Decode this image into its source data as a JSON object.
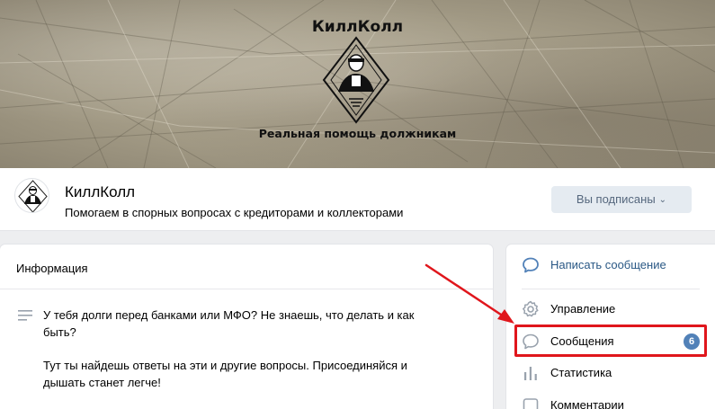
{
  "cover": {
    "title": "КиллКолл",
    "tagline": "Реальная помощь должникам"
  },
  "group": {
    "name": "КиллКолл",
    "description": "Помогаем в спорных вопросах с кредиторами и коллекторами",
    "subscribe_button": "Вы подписаны",
    "subscribe_icon": "chevron-down-icon"
  },
  "info": {
    "title": "Информация",
    "paragraph_1": "У тебя долги перед банками или МФО? Не знаешь, что делать и как быть?",
    "paragraph_2": "Тут ты найдешь ответы на эти и другие вопросы. Присоединяйся и дышать станет легче!"
  },
  "actions": {
    "write_message": "Написать сообщение",
    "manage": "Управление",
    "messages": "Сообщения",
    "messages_count": "6",
    "statistics": "Статистика",
    "comments": "Комментарии"
  },
  "colors": {
    "accent": "#5181b8",
    "link": "#2a5885",
    "annotation": "#e0161c",
    "button_bg": "#e5ebf1"
  }
}
